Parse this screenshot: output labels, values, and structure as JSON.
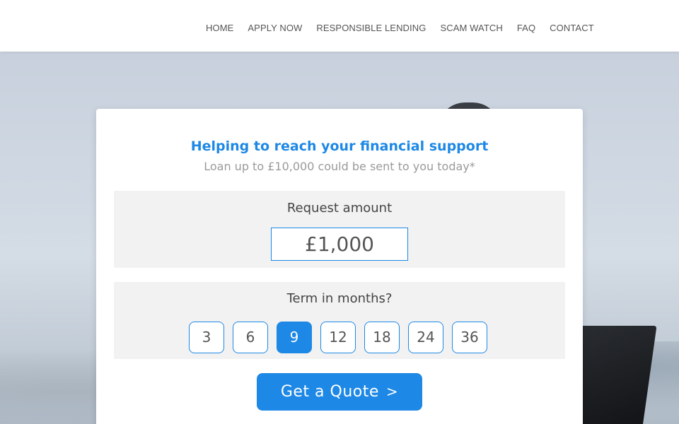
{
  "nav": {
    "items": [
      "HOME",
      "APPLY NOW",
      "RESPONSIBLE LENDING",
      "SCAM WATCH",
      "FAQ",
      "CONTACT"
    ]
  },
  "card": {
    "headline": "Helping to reach your financial support",
    "subline": "Loan up to £10,000 could be sent to you today*"
  },
  "amount": {
    "label": "Request amount",
    "value": "£1,000"
  },
  "term": {
    "label": "Term in months?",
    "options": [
      "3",
      "6",
      "9",
      "12",
      "18",
      "24",
      "36"
    ],
    "selected": "9"
  },
  "cta": {
    "label": "Get a Quote",
    "chevron": ">"
  },
  "colors": {
    "accent": "#1d88e5",
    "panel_bg": "#f2f2f2"
  },
  "icons": {
    "cta_icon": "chevron-right-icon"
  }
}
